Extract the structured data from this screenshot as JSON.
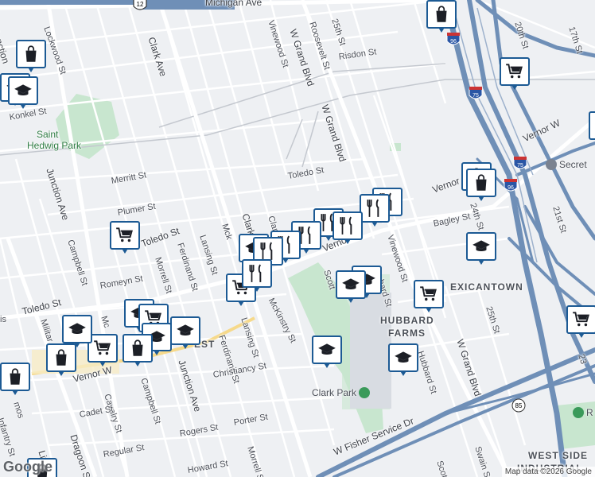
{
  "map": {
    "streets": {
      "michigan": "Michigan Ave",
      "lockwood": "Lockwood St",
      "junction_top": "Junction",
      "konkel": "Konkel St",
      "clark_ave": "Clark Ave",
      "vinewood_top": "Vinewood St",
      "w_grand_blvd_top": "W Grand Blvd",
      "roosevelt": "Roosevelt St",
      "st_25_top": "25th St",
      "risdon": "Risdon St",
      "w_grand_blvd_mid": "W Grand Blvd",
      "twentieth": "20th St",
      "seventeenth": "17th St",
      "vernor_w_right": "Vernor W",
      "junction_ave_left": "Junction Ave",
      "merritt": "Merritt St",
      "plumer": "Plumer St",
      "toledo_mid": "Toledo St",
      "toledo_left": "Toledo St",
      "toledo_far_left": "Toledo St",
      "campbell_left": "Campbell St",
      "ferdinand": "Ferdinand St",
      "lansing": "Lansing St",
      "mckinstry_top": "Mck",
      "clark_mid": "Clark A",
      "clark_small": "Clark",
      "vernor_w_mid": "Vernor W",
      "vinewood_mid": "Vinewood St",
      "vernor_right_mid": "Vernor",
      "twentyfourth": "24th St",
      "bagley": "Bagley St",
      "twentyfirst": "21st St",
      "romeyn": "Romeyn St",
      "morrell_mid": "Morrell St",
      "scotten": "Scott",
      "hubbard": "hard St",
      "mckinstry_mid": "McKinstry St",
      "lansing_low": "Lansing St",
      "ferdinand_low": "Ferdinand St",
      "junction_ave_mid": "Junction Ave",
      "campbell_low": "Campbell St",
      "christiancy": "Christiancy St",
      "vernor_w_left": "Vernor W",
      "cavalry": "Cavalry St",
      "cadet": "Cadet St",
      "militar": "Militar",
      "infantry": "Infantry St",
      "regular": "Regular St",
      "dragoon": "Dragoon St",
      "livernois": "Liverno",
      "rogers": "Rogers St",
      "porter": "Porter St",
      "morrell_low": "Morrell St",
      "howard": "Howard St",
      "w_fisher": "W Fisher Service Dr",
      "st_25_low": "25th St",
      "w_grand_blvd_low": "W Grand Blvd",
      "hubbard_low": "Hubbard St",
      "scotten_low": "Scotten",
      "swain": "Swain St",
      "twentythird": "23",
      "is_left": "is",
      "mos_left": "mos",
      "mc_left": "Mc"
    },
    "areas": {
      "mexicantown": "EXICANTOWN",
      "hubbard_farms_1": "HUBBARD",
      "hubbard_farms_2": "FARMS",
      "west_side_industrial": "WEST SIDE",
      "west_side_industrial_2": "INDUSTRIAL",
      "west": "EST"
    },
    "parks": {
      "saint_hedwig_1": "Saint",
      "saint_hedwig_2": "Hedwig Park",
      "clark_park": "Clark Park"
    },
    "pois": {
      "secret": "Secret",
      "r_right": "R"
    },
    "shields": {
      "us12": "12",
      "i96_top": "96",
      "i75": "75",
      "i75_low": "75",
      "i96_low": "96",
      "r85": "85"
    },
    "attribution": "Map data ©2026 Google",
    "logo": "Google",
    "colors": {
      "marker_border": "#1c5a94",
      "park": "#c8e6cf",
      "freeway": "#6f8fb7",
      "background": "#eef0f3"
    },
    "marker_icons": [
      "shopping-bag",
      "graduation-cap",
      "shopping-cart",
      "utensils"
    ]
  }
}
